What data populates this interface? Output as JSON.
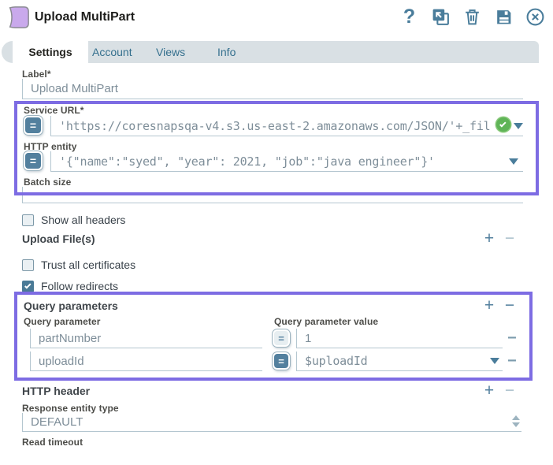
{
  "icons": {
    "help": "?",
    "equals": "=",
    "plus": "+",
    "minus": "−"
  },
  "header": {
    "title": "Upload MultiPart",
    "toolbar": [
      "help-icon",
      "export-canvas-icon",
      "delete-icon",
      "save-icon",
      "close-icon"
    ]
  },
  "tabs": [
    {
      "label": "Settings",
      "active": true
    },
    {
      "label": "Account",
      "active": false
    },
    {
      "label": "Views",
      "active": false
    },
    {
      "label": "Info",
      "active": false
    }
  ],
  "settings": {
    "label_field": {
      "label": "Label*",
      "value": "Upload MultiPart"
    },
    "service_url": {
      "label": "Service URL*",
      "value": "'https://coresnapsqa-v4.s3.us-east-2.amazonaws.com/JSON/'+_fil",
      "expression_enabled": true,
      "valid": true
    },
    "http_entity": {
      "label": "HTTP entity",
      "value": "'{\"name\":\"syed\", \"year\": 2021, \"job\":\"java engineer\"}'",
      "expression_enabled": true
    },
    "batch_size": {
      "label": "Batch size",
      "value": ""
    },
    "show_all_headers": {
      "label": "Show all headers",
      "checked": false
    },
    "upload_files": {
      "title": "Upload File(s)"
    },
    "trust_all_certificates": {
      "label": "Trust all certificates",
      "checked": false
    },
    "follow_redirects": {
      "label": "Follow redirects",
      "checked": true
    },
    "query_parameters": {
      "title": "Query parameters",
      "columns": {
        "name": "Query parameter",
        "value": "Query parameter value"
      },
      "rows": [
        {
          "name": "partNumber",
          "value": "1",
          "expression_enabled": false
        },
        {
          "name": "uploadId",
          "value": "$uploadId",
          "expression_enabled": true
        }
      ]
    },
    "http_header": {
      "title": "HTTP header"
    },
    "response_entity_type": {
      "label": "Response entity type",
      "value": "DEFAULT"
    },
    "read_timeout": {
      "label": "Read timeout",
      "value": ""
    }
  },
  "colors": {
    "accent": "#53809e",
    "annotation": "#7d6ce3",
    "valid_badge": "#5fb457",
    "snap_icon_fill": "#c9a9ec",
    "tabbar_bg": "#d9e0e4"
  }
}
